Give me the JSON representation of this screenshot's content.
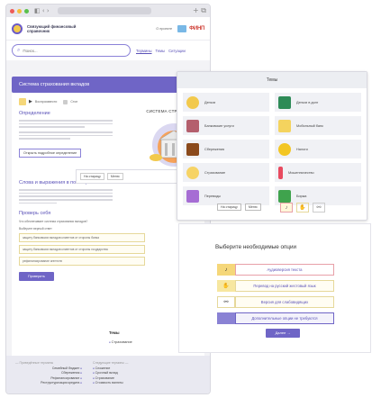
{
  "browser": {
    "nav_glyphs": "◧  ‹  ›",
    "url": "",
    "new_tab": "+ ⧉"
  },
  "header": {
    "site_name": "Связующий финансовый справочник",
    "link": "О проекте",
    "partner_logo": "ФИНП"
  },
  "search": {
    "placeholder": "Поиск...",
    "links": [
      "Термины",
      "Темы",
      "Ситуации"
    ]
  },
  "article": {
    "banner": "Система страхования вкладов",
    "audio_label": "Воспроизвести",
    "stop_label": "Стоп",
    "definition_heading": "Определение",
    "illustration_title": "СИСТЕМА СТРАХОВАНИЯ",
    "open_button": "Открыть подробное определение",
    "words_heading": "Слова и выражения в помощь",
    "check_heading": "Проверь себя",
    "quiz_question": "Что обеспечивает система страхования вкладов?",
    "quiz_hint": "Выберите верный ответ",
    "quiz_options": [
      "защиту банковских вкладов клиентов от стороны банка",
      "защиту банковских вкладов клиентов от стороны государства",
      "рефинансирование агентств"
    ],
    "check_button": "Проверить"
  },
  "themes_mini": {
    "title": "Темы",
    "item": "Страхование"
  },
  "footer": {
    "left_heading": "— Приведённые термины",
    "right_heading": "Следующие термины —",
    "left_items": [
      "Семейный бюджет",
      "Сбережения",
      "Рефинансирование",
      "Реструктуризация кредита"
    ],
    "right_items": [
      "Сложение",
      "Срочный вклад",
      "Страхование",
      "Стоимость валюты"
    ]
  },
  "acc_bar": {
    "btn_back": "На старицу",
    "btn_menu": "Меню"
  },
  "themes_panel": {
    "title": "Темы",
    "tiles": [
      {
        "label": "Деньги",
        "color": "#f2c94c"
      },
      {
        "label": "Деньги в долг",
        "color": "#2e8b57"
      },
      {
        "label": "Банковские услуги",
        "color": "#b45f6d"
      },
      {
        "label": "Мобильный банк",
        "color": "#f4d35e"
      },
      {
        "label": "Сбережения",
        "color": "#8b4a1c"
      },
      {
        "label": "Налоги",
        "color": "#f3c623"
      },
      {
        "label": "Страхование",
        "color": "#f6d365"
      },
      {
        "label": "Мошенничество",
        "color": "#e84a5f"
      },
      {
        "label": "Переводы",
        "color": "#a66dd4"
      },
      {
        "label": "Биржа",
        "color": "#3fa34d"
      }
    ],
    "btn_back": "На старицу",
    "btn_menu": "Меню"
  },
  "options_dialog": {
    "title": "Выберите необходимые опции",
    "items": [
      {
        "label": "Аудиоверсия текста",
        "border": "#e8a0a8",
        "bg": "#ffffff",
        "icon_bg": "#f5d77a"
      },
      {
        "label": "Перевод на русский жестовый язык",
        "border": "#e6d89a",
        "bg": "#fffdf3",
        "icon_bg": "#f7e7a0"
      },
      {
        "label": "Версия для слабовидящих",
        "border": "#e6d89a",
        "bg": "#fffdf3",
        "icon_bg": "#ffffff"
      },
      {
        "label": "Дополнительные опции не требуются",
        "border": "#6f65c6",
        "bg": "#f3f2fb",
        "icon_bg": "#8a82d4"
      }
    ],
    "proceed": "Далее →"
  }
}
